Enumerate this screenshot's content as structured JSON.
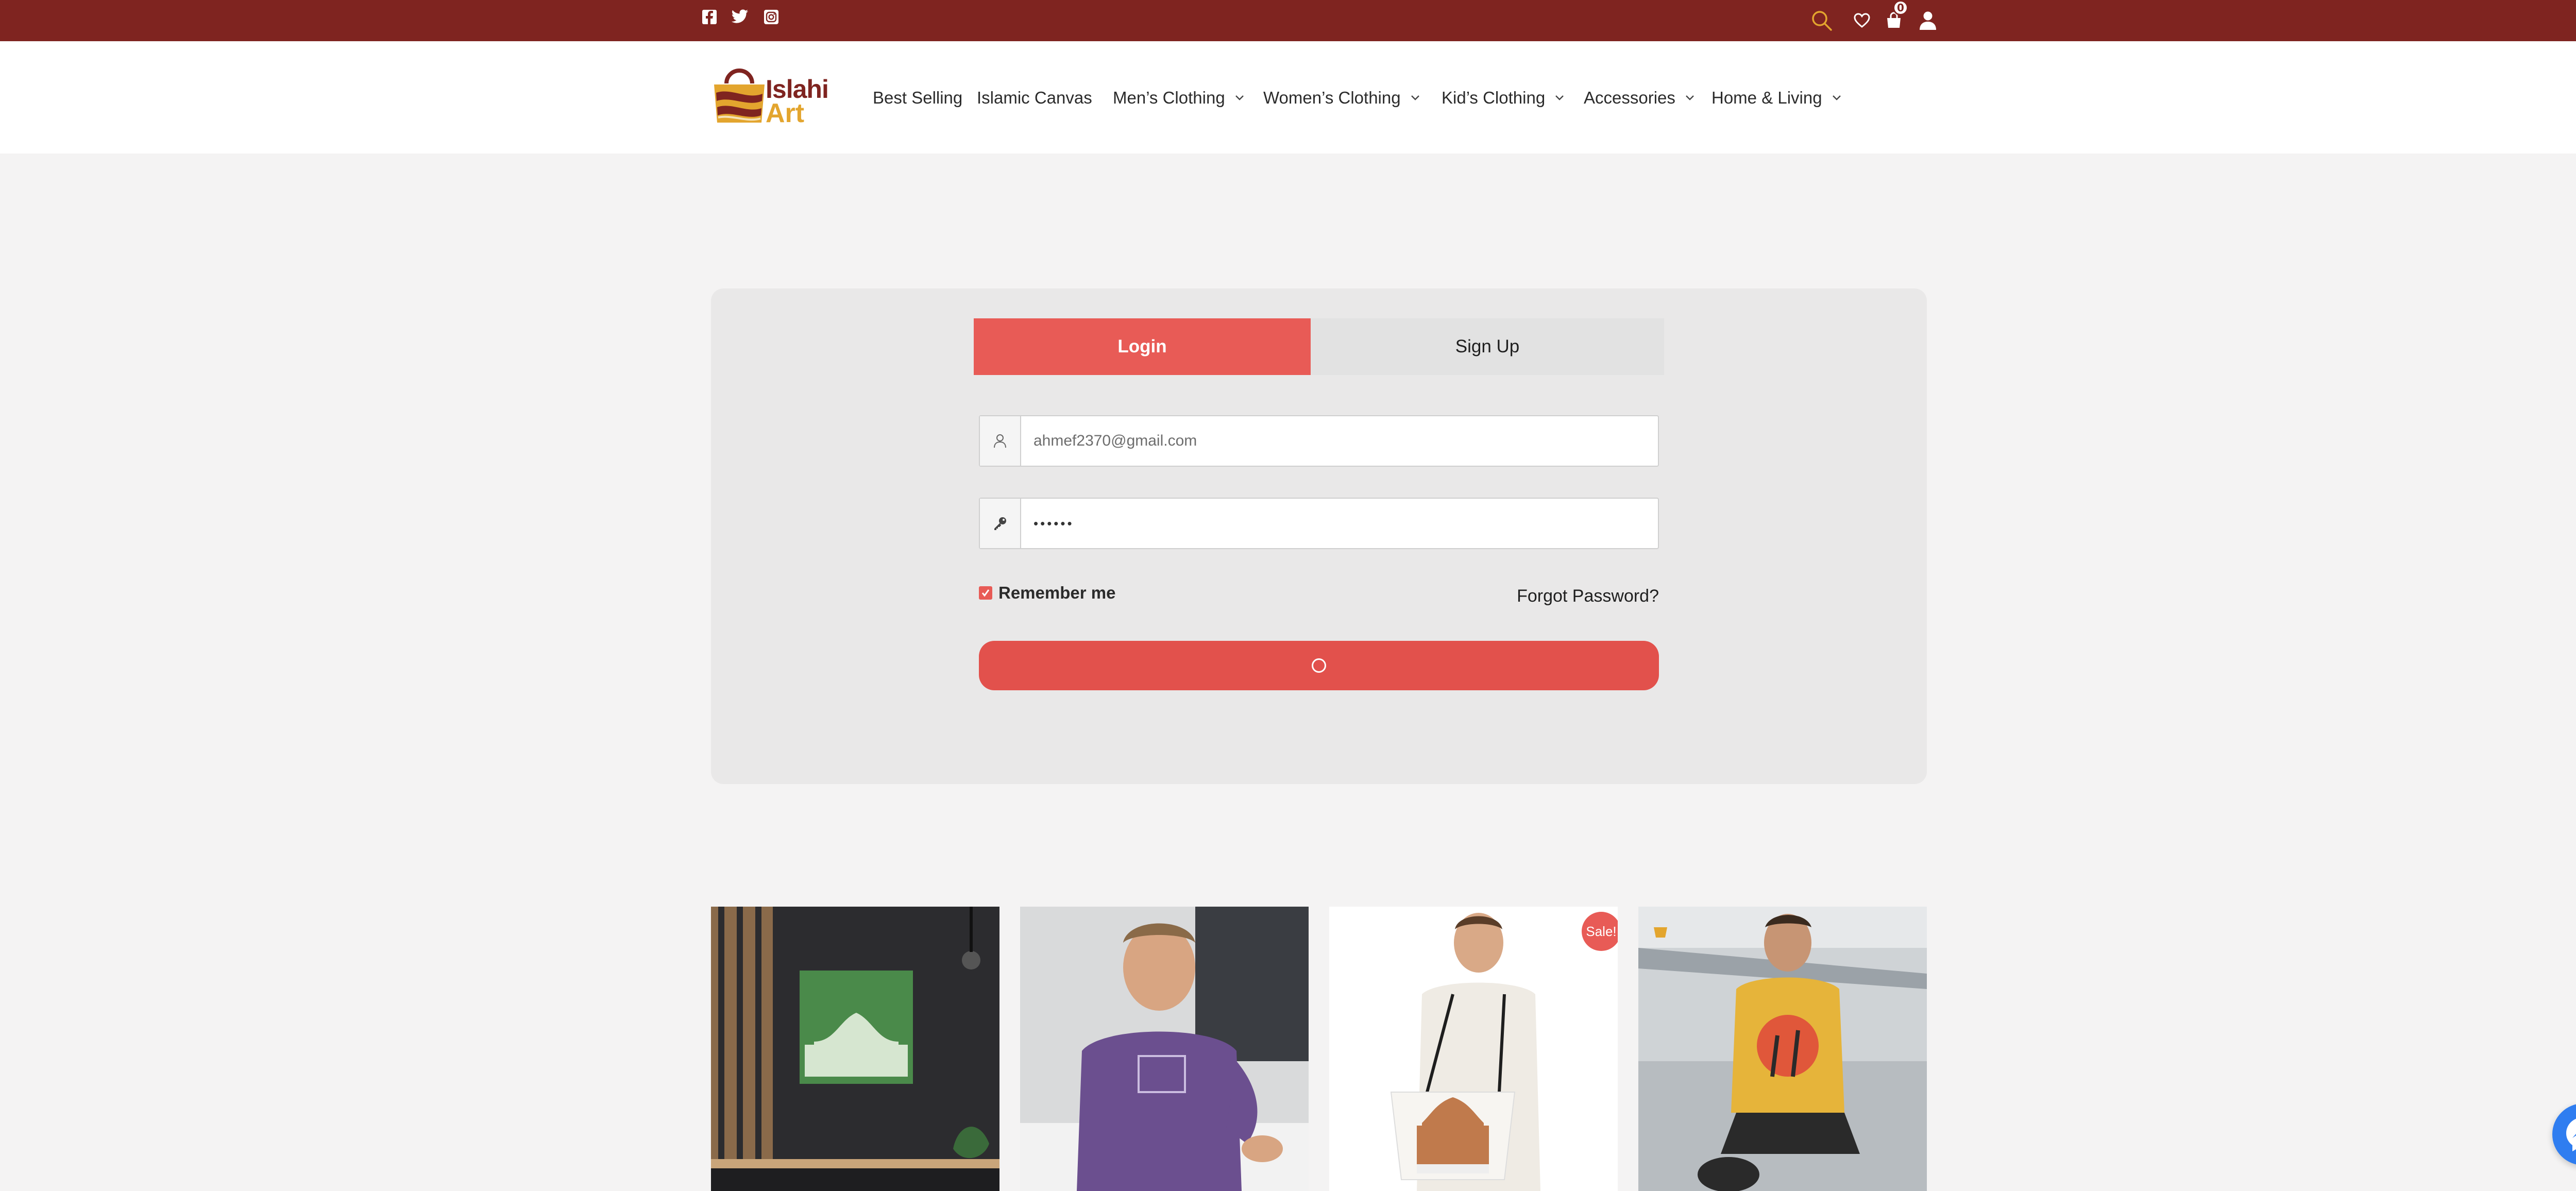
{
  "topbar": {
    "social_icons": [
      "facebook-icon",
      "twitter-icon",
      "instagram-icon"
    ],
    "right_icons": [
      "search-icon",
      "heart-icon",
      "cart-icon",
      "user-icon"
    ],
    "cart_count": "0",
    "bg_color": "#7f2420"
  },
  "header": {
    "logo": {
      "line1": "Islahi",
      "line2": "Art"
    },
    "nav": [
      {
        "label": "Best Selling",
        "has_dropdown": false
      },
      {
        "label": "Islamic Canvas",
        "has_dropdown": false
      },
      {
        "label": "Men’s Clothing",
        "has_dropdown": true
      },
      {
        "label": "Women’s Clothing",
        "has_dropdown": true
      },
      {
        "label": "Kid’s Clothing",
        "has_dropdown": true
      },
      {
        "label": "Accessories",
        "has_dropdown": true
      },
      {
        "label": "Home & Living",
        "has_dropdown": true
      }
    ]
  },
  "auth": {
    "tabs": {
      "login": "Login",
      "signup": "Sign Up"
    },
    "email_value": "ahmef2370@gmail.com",
    "password_value": "••••••",
    "remember_label": "Remember me",
    "remember_checked": true,
    "forgot_label": "Forgot Password?",
    "accent_color": "#e85b56"
  },
  "products": [
    {
      "name": "islamic-canvas-product",
      "sale": false
    },
    {
      "name": "purple-tshirt-product",
      "sale": false
    },
    {
      "name": "mosque-tote-bag-product",
      "sale": true,
      "badge": "Sale!"
    },
    {
      "name": "yellow-tshirt-product",
      "sale": false
    }
  ],
  "chat": {
    "icon": "messenger-icon"
  }
}
